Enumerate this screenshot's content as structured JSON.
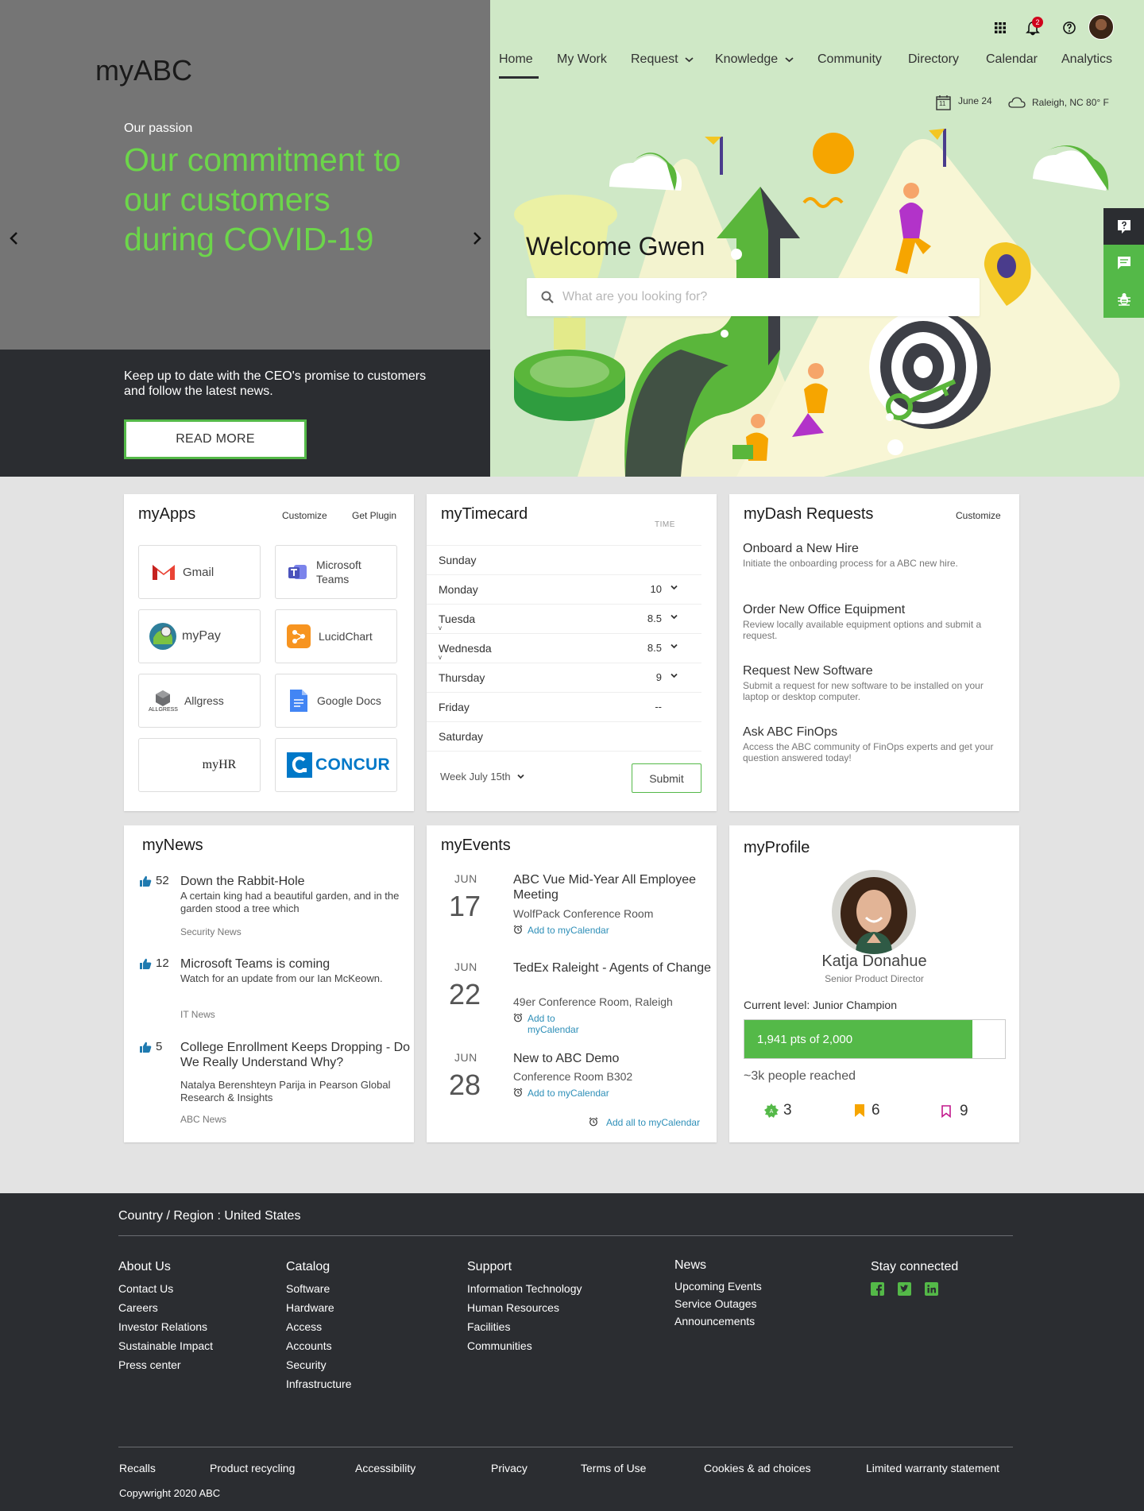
{
  "brand": {
    "logo": "myABC"
  },
  "hero": {
    "subtitle": "Our passion",
    "title": "Our commitment to our customers during COVID-19",
    "description": "Keep up to date with the CEO's promise to customers and follow the latest news.",
    "cta": "READ MORE"
  },
  "header": {
    "notification_count": "2",
    "nav": [
      "Home",
      "My Work",
      "Request",
      "Knowledge",
      "Community",
      "Directory",
      "Calendar",
      "Analytics"
    ],
    "calendar_day": "11",
    "date": "June 24",
    "weather": "Raleigh, NC  80° F"
  },
  "welcome": {
    "greeting": "Welcome Gwen",
    "search_placeholder": "What are you looking for?"
  },
  "myapps": {
    "title": "myApps",
    "customize": "Customize",
    "get_plugin": "Get Plugin",
    "apps": [
      "Gmail",
      "Microsoft Teams",
      "myPay",
      "LucidChart",
      "Allgress",
      "Google Docs",
      "myHR",
      "CONCUR"
    ],
    "allgress_logo_text": "ALLGRESS"
  },
  "timecard": {
    "title": "myTimecard",
    "col": "TIME",
    "rows": [
      {
        "day": "Sunday",
        "val": ""
      },
      {
        "day": "Monday",
        "val": "10"
      },
      {
        "day": "Tuesda",
        "val": "8.5"
      },
      {
        "day": "Wednesda",
        "val": "8.5"
      },
      {
        "day": "Thursday",
        "val": "9"
      },
      {
        "day": "Friday",
        "val": "--"
      },
      {
        "day": "Saturday",
        "val": ""
      }
    ],
    "week": "Week July 15th",
    "submit": "Submit"
  },
  "dash": {
    "title": "myDash Requests",
    "customize": "Customize",
    "items": [
      {
        "title": "Onboard a New Hire",
        "desc": "Initiate the onboarding process for a ABC new hire."
      },
      {
        "title": "Order New Office Equipment",
        "desc": "Review locally available equipment options and submit a request."
      },
      {
        "title": "Request New Software",
        "desc": "Submit a request for new software to be installed on your laptop or desktop computer."
      },
      {
        "title": "Ask ABC FinOps",
        "desc": "Access the ABC community of FinOps experts and get your question answered today!"
      }
    ]
  },
  "news": {
    "title": "myNews",
    "items": [
      {
        "likes": "52",
        "title": "Down the Rabbit-Hole",
        "desc": "A certain king had a beautiful garden, and in the garden stood a tree which",
        "cat": "Security News"
      },
      {
        "likes": "12",
        "title": "Microsoft Teams is coming",
        "desc": "Watch for an update from our Ian McKeown.",
        "cat": "IT News"
      },
      {
        "likes": "5",
        "title": "College Enrollment Keeps Dropping - Do We Really Understand Why?",
        "desc": "Natalya Berenshteyn Parija in Pearson Global Research & Insights",
        "cat": "ABC News"
      }
    ]
  },
  "events": {
    "title": "myEvents",
    "items": [
      {
        "mon": "JUN",
        "day": "17",
        "title": "ABC Vue Mid-Year All Employee Meeting",
        "loc": "WolfPack Conference Room",
        "add": "Add to myCalendar"
      },
      {
        "mon": "JUN",
        "day": "22",
        "title": "TedEx Raleight - Agents of Change",
        "loc": "49er Conference Room, Raleigh",
        "add": "Add to myCalendar"
      },
      {
        "mon": "JUN",
        "day": "28",
        "title": "New to ABC Demo",
        "loc": "Conference Room B302",
        "add": "Add to myCalendar"
      }
    ],
    "add_all": "Add all to myCalendar"
  },
  "profile": {
    "title": "myProfile",
    "name": "Katja Donahue",
    "role": "Senior Product Director",
    "level": "Current level: Junior Champion",
    "points": "1,941 pts of 2,000",
    "points_value": 1941,
    "points_max": 2000,
    "reach": "~3k people reached",
    "stats": [
      "3",
      "6",
      "9"
    ]
  },
  "footer": {
    "region": "Country / Region : United States",
    "cols": [
      {
        "title": "About Us",
        "links": [
          "Contact Us",
          "Careers",
          "Investor Relations",
          "Sustainable Impact",
          "Press center"
        ]
      },
      {
        "title": "Catalog",
        "links": [
          "Software",
          "Hardware",
          "Access",
          "Accounts",
          "Security",
          "Infrastructure"
        ]
      },
      {
        "title": "Support",
        "links": [
          "Information Technology",
          "Human Resources",
          "Facilities",
          "Communities"
        ]
      },
      {
        "title": "News",
        "links": [
          "Upcoming Events",
          "Service Outages",
          "Announcements"
        ]
      }
    ],
    "stay": "Stay connected",
    "bottom": [
      "Recalls",
      "Product recycling",
      "Accessibility",
      "Privacy",
      "Terms of Use",
      "Cookies & ad choices",
      "Limited warranty statement"
    ],
    "copyright": "Copywright 2020 ABC"
  },
  "colors": {
    "accent": "#54b948",
    "hero_green": "#6cd64a",
    "dark": "#2b2d31",
    "link": "#2e8fb8"
  }
}
